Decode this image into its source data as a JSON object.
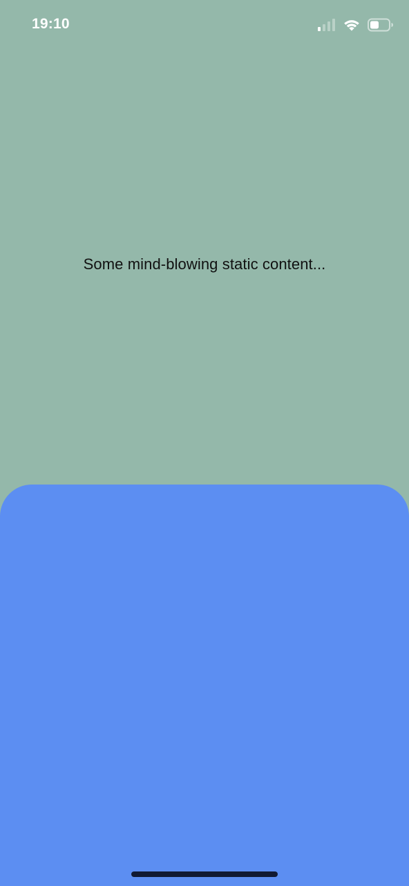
{
  "status_bar": {
    "time": "19:10",
    "icons": [
      "signal-icon",
      "wifi-icon",
      "battery-icon"
    ]
  },
  "main": {
    "text": "Some mind-blowing static content..."
  },
  "colors": {
    "background": "#94B8AA",
    "sheet": "#5C8EF2",
    "home_indicator": "#111A33",
    "text": "#111111",
    "status_icons": "#FFFFFF"
  }
}
